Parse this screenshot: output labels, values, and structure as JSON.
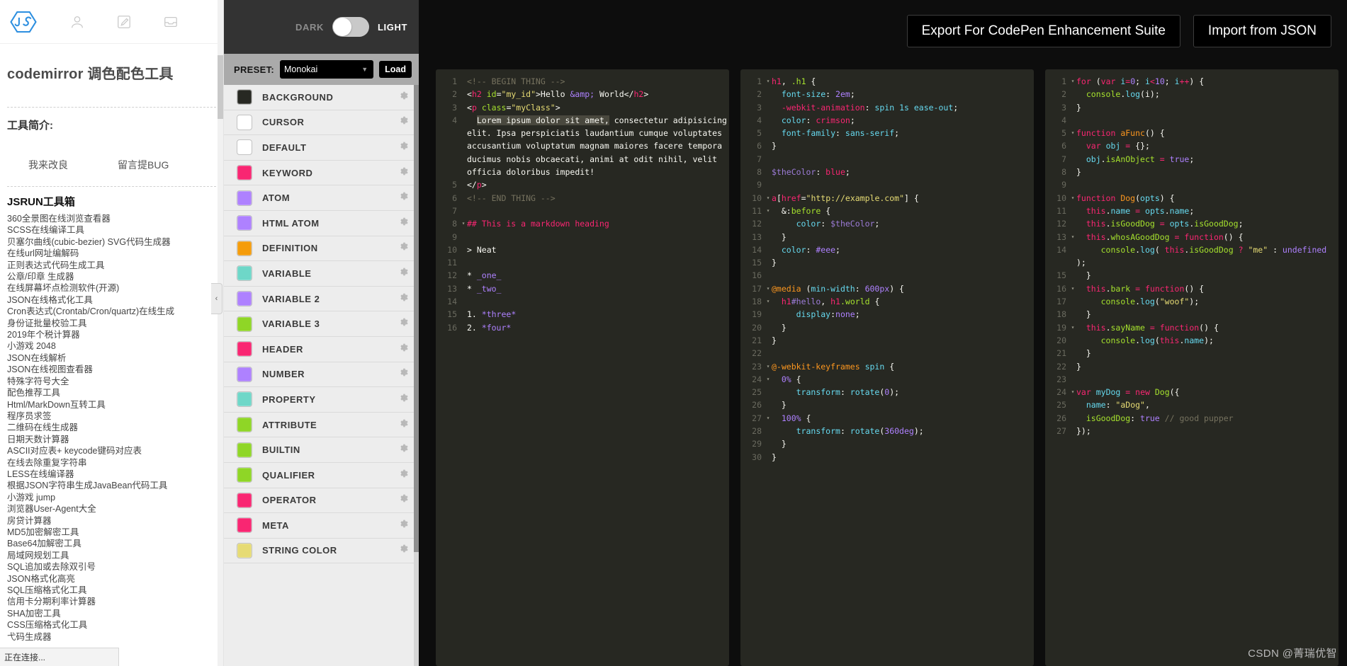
{
  "sidebar": {
    "brand_icon": "js-hexagon-logo",
    "top_icons": [
      "user-icon",
      "edit-icon",
      "feedback-icon"
    ],
    "title": "codemirror 调色配色工具",
    "intro_heading": "工具简介:",
    "links": [
      "我来改良",
      "留言提BUG"
    ],
    "toolbox_heading": "JSRUN工具箱",
    "tools": [
      "360全景图在线浏览查看器",
      "SCSS在线编译工具",
      "贝塞尔曲线(cubic-bezier) SVG代码生成器",
      "在线url网址编解码",
      "正则表达式代码生成工具",
      "公章/印章 生成器",
      "在线屏幕坏点检测软件(开源)",
      "JSON在线格式化工具",
      "Cron表达式(Crontab/Cron/quartz)在线生成",
      "身份证批量校验工具",
      "2019年个税计算器",
      "小游戏 2048",
      "JSON在线解析",
      "JSON在线视图查看器",
      "特殊字符号大全",
      "配色推荐工具",
      "Html/MarkDown互转工具",
      "程序员求签",
      "二维码在线生成器",
      "日期天数计算器",
      "ASCII对应表+ keycode键码对应表",
      "在线去除重复字符串",
      "LESS在线编译器",
      "根据JSON字符串生成JavaBean代码工具",
      "小游戏 jump",
      "浏览器User-Agent大全",
      "房贷计算器",
      "MD5加密解密工具",
      "Base64加解密工具",
      "局域网规划工具",
      "SQL追加或去除双引号",
      "JSON格式化高亮",
      "SQL压缩格式化工具",
      "信用卡分期利率计算器",
      "SHA加密工具",
      "CSS压缩格式化工具",
      "弋码生成器"
    ],
    "status_text": "正在连接...",
    "collapse_handle": "‹"
  },
  "theme_panel": {
    "mode_dark_label": "DARK",
    "mode_light_label": "LIGHT",
    "toggle_state": "light",
    "preset_label": "PRESET:",
    "preset_value": "Monokai",
    "preset_options": [
      "Monokai"
    ],
    "load_label": "Load",
    "gear_icon": "gear-icon",
    "swatches": [
      {
        "name": "BACKGROUND",
        "color": "#272822"
      },
      {
        "name": "CURSOR",
        "color": "#ffffff"
      },
      {
        "name": "DEFAULT",
        "color": "#ffffff"
      },
      {
        "name": "KEYWORD",
        "color": "#f92672"
      },
      {
        "name": "ATOM",
        "color": "#ae81ff"
      },
      {
        "name": "HTML ATOM",
        "color": "#ae81ff"
      },
      {
        "name": "DEFINITION",
        "color": "#f59c0b"
      },
      {
        "name": "VARIABLE",
        "color": "#6ed7c8"
      },
      {
        "name": "VARIABLE 2",
        "color": "#ae81ff"
      },
      {
        "name": "VARIABLE 3",
        "color": "#8fd626"
      },
      {
        "name": "HEADER",
        "color": "#f92672"
      },
      {
        "name": "NUMBER",
        "color": "#ae81ff"
      },
      {
        "name": "PROPERTY",
        "color": "#6ed7c8"
      },
      {
        "name": "ATTRIBUTE",
        "color": "#8fd626"
      },
      {
        "name": "BUILTIN",
        "color": "#8fd626"
      },
      {
        "name": "QUALIFIER",
        "color": "#8fd626"
      },
      {
        "name": "OPERATOR",
        "color": "#f92672"
      },
      {
        "name": "META",
        "color": "#f92672"
      },
      {
        "name": "STRING COLOR",
        "color": "#e6db74"
      }
    ]
  },
  "header": {
    "export_button": "Export For CodePen Enhancement Suite",
    "import_button": "Import from JSON"
  },
  "watermark": "CSDN @菁瑞优智"
}
